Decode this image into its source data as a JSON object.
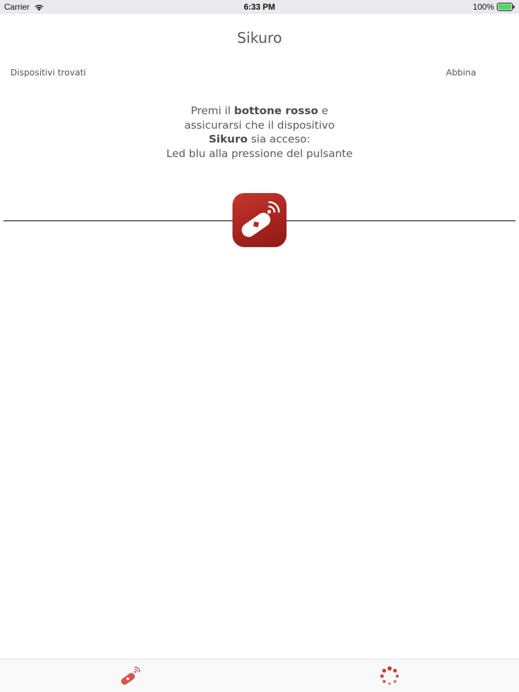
{
  "status_bar": {
    "carrier": "Carrier",
    "time": "6:33 PM",
    "battery": "100%",
    "battery_color": "#4cd964"
  },
  "nav": {
    "title": "Sikuro"
  },
  "header": {
    "found_label": "Dispositivi trovati",
    "pair_label": "Abbina"
  },
  "instructions": {
    "line1_pre": "Premi il ",
    "line1_bold": "bottone rosso",
    "line1_post": " e",
    "line2": "assicurarsi che il dispositivo",
    "line3_bold": "Sikuro",
    "line3_post": " sia acceso:",
    "line4": "Led blu alla pressione del pulsante"
  },
  "logo": {
    "icon": "sikuro-device-icon",
    "background_color": "#a8241f"
  },
  "tab_bar": {
    "tabs": [
      {
        "icon": "sikuro-device-icon",
        "color": "#d9534f"
      },
      {
        "icon": "loading-spinner-icon",
        "color": "#c0392b"
      }
    ]
  }
}
